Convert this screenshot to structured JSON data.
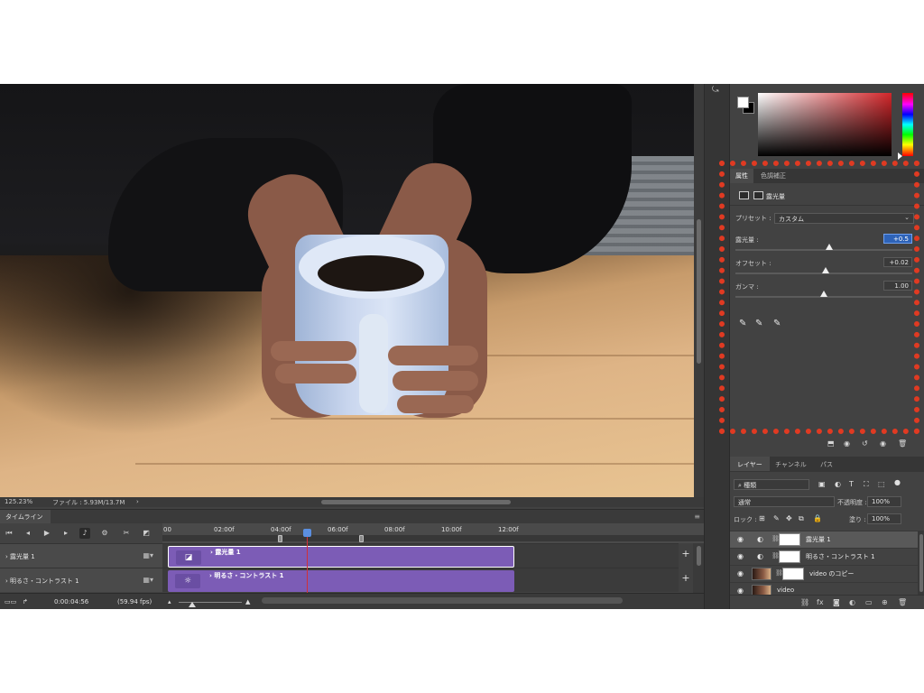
{
  "status": {
    "zoom": "125.23%",
    "file_label": "ファイル : 5.93M/13.7M",
    "arrow": "›"
  },
  "timeline": {
    "tab_label": "タイムライン",
    "menu_icon": "menu-icon",
    "ruler_labels": [
      "00",
      "02:00f",
      "04:00f",
      "06:00f",
      "08:00f",
      "10:00f",
      "12:00f"
    ],
    "tracks": [
      {
        "name": "露光量 1",
        "clip_label": "露光量 1",
        "icon": "exposure-icon",
        "selected": true
      },
      {
        "name": "明るさ・コントラスト 1",
        "clip_label": "明るさ・コントラスト 1",
        "icon": "brightness-icon",
        "selected": false
      }
    ],
    "timecode": "0:00:04:56",
    "fps": "(59.94 fps)",
    "plus": "+"
  },
  "properties": {
    "tabs": [
      "属性",
      "色調補正"
    ],
    "layer_title": "露光量",
    "preset_label": "プリセット :",
    "preset_value": "カスタム",
    "exposure_label": "露光量 :",
    "exposure_value": "+0.5",
    "exposure_level": 0.53,
    "offset_label": "オフセット :",
    "offset_value": "+0.02",
    "offset_level": 0.51,
    "gamma_label": "ガンマ :",
    "gamma_value": "1.00",
    "gamma_level": 0.5
  },
  "layers": {
    "tabs": [
      "レイヤー",
      "チャンネル",
      "パス"
    ],
    "kind_label": "種類",
    "blend_mode": "通常",
    "opacity_label": "不透明度 :",
    "opacity_value": "100%",
    "lock_label": "ロック :",
    "fill_label": "塗り :",
    "fill_value": "100%",
    "rows": [
      {
        "name": "露光量 1",
        "selected": true,
        "type": "adjustment"
      },
      {
        "name": "明るさ・コントラスト 1",
        "selected": false,
        "type": "adjustment"
      },
      {
        "name": "video のコピー",
        "selected": false,
        "type": "video-mask"
      },
      {
        "name": "video",
        "selected": false,
        "type": "video"
      }
    ]
  },
  "colors": {
    "clip_purple": "#7c5cb6",
    "highlight_red": "#e03a22",
    "playhead_blue": "#5b8fe0"
  }
}
